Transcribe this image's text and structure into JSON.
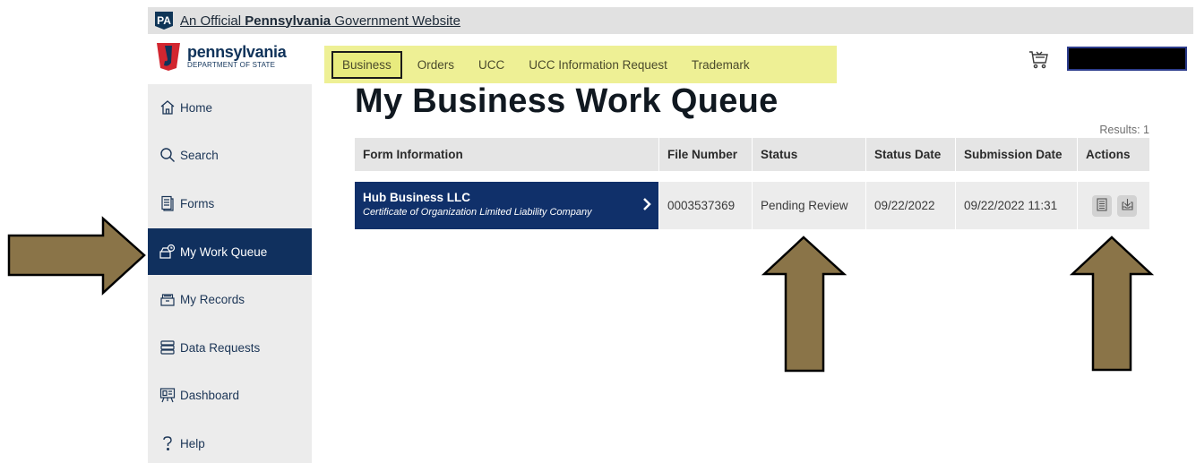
{
  "banner": {
    "badge": "PA",
    "prefix": "An Official ",
    "state": "Pennsylvania",
    "suffix": " Government Website"
  },
  "logo": {
    "name": "pennsylvania",
    "subtitle": "DEPARTMENT OF STATE"
  },
  "topnav": {
    "items": [
      {
        "label": "Business",
        "active": true
      },
      {
        "label": "Orders"
      },
      {
        "label": "UCC"
      },
      {
        "label": "UCC Information Request"
      },
      {
        "label": "Trademark"
      }
    ]
  },
  "header": {
    "cart_icon": "cart-icon",
    "account_redacted": true
  },
  "sidebar": {
    "items": [
      {
        "label": "Home",
        "icon": "home-icon"
      },
      {
        "label": "Search",
        "icon": "search-icon"
      },
      {
        "label": "Forms",
        "icon": "forms-icon"
      },
      {
        "label": "My Work Queue",
        "icon": "work-queue-icon",
        "active": true
      },
      {
        "label": "My Records",
        "icon": "records-icon"
      },
      {
        "label": "Data Requests",
        "icon": "database-icon"
      },
      {
        "label": "Dashboard",
        "icon": "dashboard-icon"
      },
      {
        "label": "Help",
        "icon": "help-icon"
      }
    ]
  },
  "main": {
    "title": "My Business Work Queue",
    "results": "Results: 1",
    "columns": [
      "Form Information",
      "File Number",
      "Status",
      "Status Date",
      "Submission Date",
      "Actions"
    ],
    "rows": [
      {
        "form_name": "Hub Business LLC",
        "form_desc": "Certificate of Organization  Limited Liability Company",
        "file_number": "0003537369",
        "status": "Pending Review",
        "status_date": "09/22/2022",
        "submission_date": "09/22/2022 11:31",
        "actions": [
          "document-icon",
          "download-icon"
        ]
      }
    ]
  },
  "colors": {
    "navy": "#10305e",
    "nav_highlight": "#eef095",
    "arrow_fill": "#8a7448"
  }
}
